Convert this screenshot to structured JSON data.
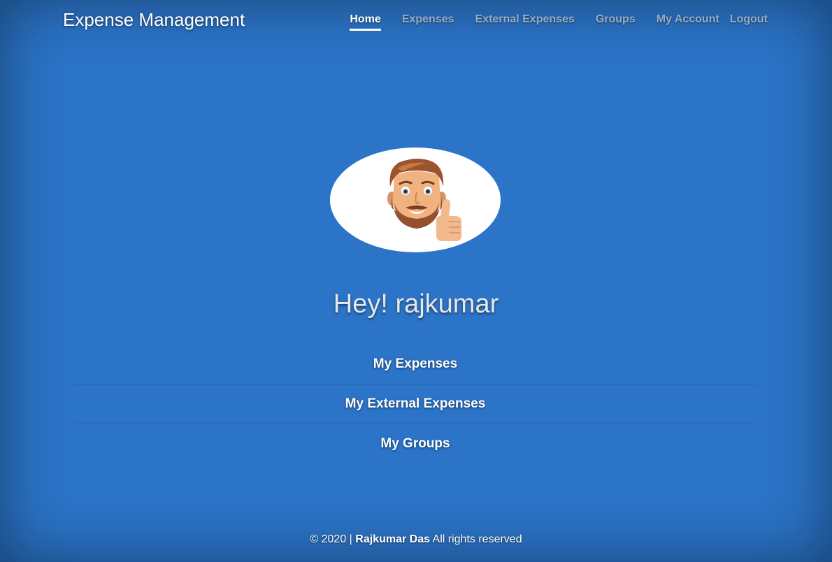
{
  "header": {
    "brand": "Expense Management",
    "nav": [
      {
        "label": "Home",
        "active": true
      },
      {
        "label": "Expenses",
        "active": false
      },
      {
        "label": "External Expenses",
        "active": false
      },
      {
        "label": "Groups",
        "active": false
      },
      {
        "label": "My Account",
        "active": false
      },
      {
        "label": "Logout",
        "active": false
      }
    ]
  },
  "main": {
    "avatar_icon": "memoji-thumbs-up-icon",
    "greeting": "Hey! rajkumar",
    "links": [
      "My Expenses",
      "My External Expenses",
      "My Groups"
    ]
  },
  "footer": {
    "prefix": "© 2020 | ",
    "author": "Rajkumar Das",
    "suffix": " All rights reserved"
  },
  "colors": {
    "background": "#2b74c8",
    "text": "#ffffff",
    "nav_inactive": "rgba(255,255,255,0.55)"
  }
}
